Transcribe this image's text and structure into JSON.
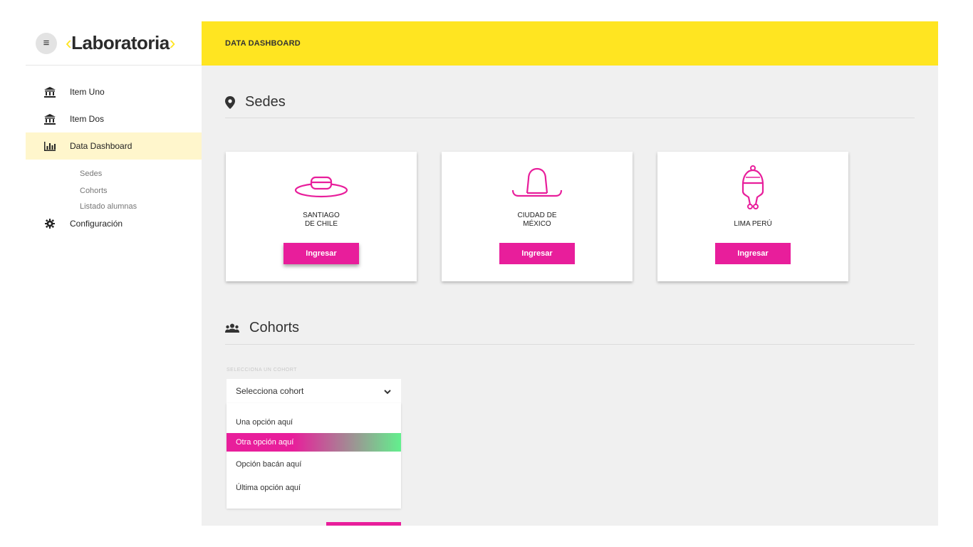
{
  "brand": {
    "logo_text": "Laboratoria",
    "bracket_left": "‹",
    "bracket_right": "›"
  },
  "header": {
    "title": "DATA DASHBOARD"
  },
  "sidebar": {
    "items": [
      {
        "label": "Item Uno",
        "icon": "bank-icon"
      },
      {
        "label": "Item Dos",
        "icon": "bank-icon"
      },
      {
        "label": "Data Dashboard",
        "icon": "bar-chart-icon",
        "active": true
      }
    ],
    "subitems": [
      {
        "label": "Sedes"
      },
      {
        "label": "Cohorts"
      },
      {
        "label": "Listado alumnas"
      }
    ],
    "config": {
      "label": "Configuración",
      "icon": "gear-icon"
    }
  },
  "sedes": {
    "title": "Sedes",
    "cards": [
      {
        "label": "SANTIAGO\nDE CHILE",
        "button": "Ingresar",
        "icon": "chilean-hat-icon"
      },
      {
        "label": "CIUDAD DE\nMÉXICO",
        "button": "Ingresar",
        "icon": "sombrero-icon"
      },
      {
        "label": "LIMA PERÚ",
        "button": "Ingresar",
        "icon": "chullo-hat-icon"
      }
    ]
  },
  "cohorts": {
    "title": "Cohorts",
    "select_label": "SELECCIONA UN COHORT",
    "select_value": "Selecciona cohort",
    "options": [
      {
        "label": "Una opción aquí"
      },
      {
        "label": "Otra opción aquí",
        "selected": true
      },
      {
        "label": "Opción bacán aquí"
      },
      {
        "label": "Última opción aquí"
      }
    ]
  },
  "colors": {
    "accent_yellow": "#ffe521",
    "accent_pink": "#e81e9b",
    "accent_green": "#62f08d"
  }
}
